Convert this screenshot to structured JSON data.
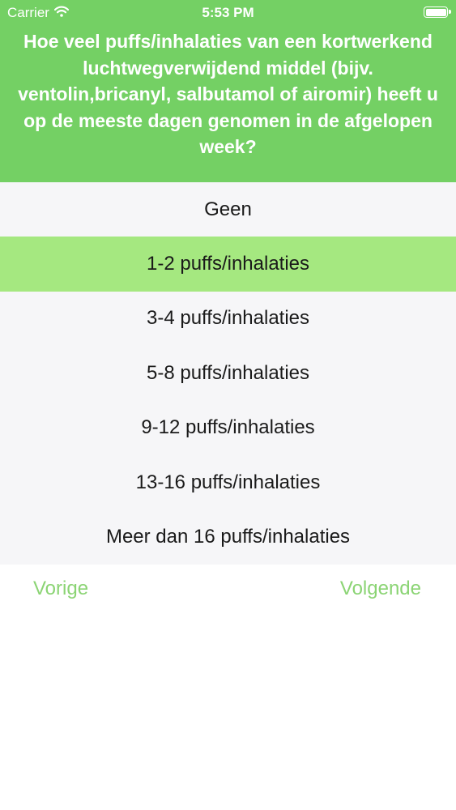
{
  "status_bar": {
    "carrier": "Carrier",
    "time": "5:53 PM",
    "wifi_icon": "wifi-icon",
    "battery_icon": "battery-icon",
    "battery_level": 1.0
  },
  "question": "Hoe veel puffs/inhalaties van een kortwerkend luchtwegverwijdend middel (bijv. ventolin,bricanyl, salbutamol of airomir) heeft u op de meeste dagen genomen in de afgelopen week?",
  "options": [
    {
      "label": "Geen",
      "selected": false
    },
    {
      "label": "1-2 puffs/inhalaties",
      "selected": true
    },
    {
      "label": "3-4 puffs/inhalaties",
      "selected": false
    },
    {
      "label": "5-8 puffs/inhalaties",
      "selected": false
    },
    {
      "label": "9-12 puffs/inhalaties",
      "selected": false
    },
    {
      "label": "13-16 puffs/inhalaties",
      "selected": false
    },
    {
      "label": "Meer dan 16 puffs/inhalaties",
      "selected": false
    }
  ],
  "navigation": {
    "previous_label": "Vorige",
    "next_label": "Volgende"
  },
  "colors": {
    "header_bg": "#74d064",
    "selected_bg": "#a5e880",
    "list_bg": "#f6f6f8",
    "nav_text": "#8bd474"
  }
}
